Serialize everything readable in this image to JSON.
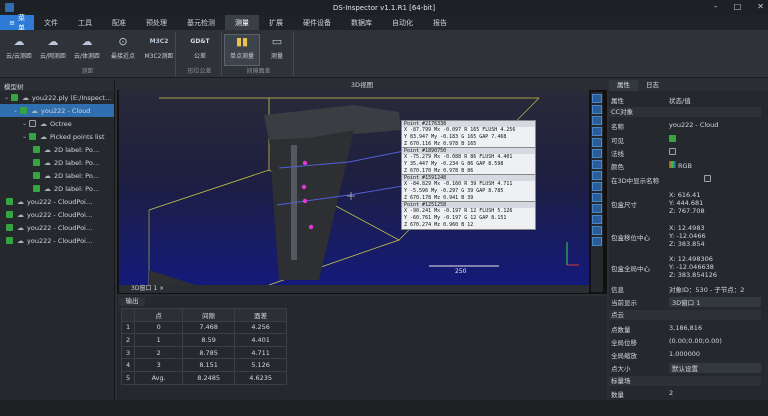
{
  "window": {
    "title": "DS-Inspector v1.1.R1 [64-bit]"
  },
  "menu": {
    "file_label": "菜单",
    "tabs": [
      "文件",
      "工具",
      "配准",
      "预处理",
      "基元检测",
      "测量",
      "扩展",
      "硬件设备",
      "数据库",
      "自动化",
      "报告"
    ],
    "active": "测量"
  },
  "ribbon": {
    "groups": [
      {
        "title": "测距",
        "buttons": [
          "云/云测距",
          "云/网测距",
          "云/体测距",
          "最接近点",
          "M3C2测距"
        ]
      },
      {
        "title": "形位公差",
        "buttons": [
          "公差"
        ]
      },
      {
        "title": "间隙面差",
        "buttons": [
          "单点测量",
          "测量"
        ]
      }
    ],
    "gdt_icon_text": "GD&T",
    "m3c2_icon_text": "M3C2"
  },
  "tree": {
    "header": "模型树",
    "items": [
      {
        "label": "you222.ply (E:/Inspect…",
        "level": 1,
        "checked": true,
        "selected": false
      },
      {
        "label": "you222 - Cloud",
        "level": 2,
        "checked": true,
        "selected": true
      },
      {
        "label": "Octree",
        "level": 3,
        "checked": false,
        "selected": false
      },
      {
        "label": "Picked points list",
        "level": 3,
        "checked": true,
        "selected": false
      },
      {
        "label": "2D label: Po…",
        "level": 4,
        "checked": true,
        "selected": false
      },
      {
        "label": "2D label: Po…",
        "level": 4,
        "checked": true,
        "selected": false
      },
      {
        "label": "2D label: Po…",
        "level": 4,
        "checked": true,
        "selected": false
      },
      {
        "label": "2D label: Po…",
        "level": 4,
        "checked": true,
        "selected": false
      },
      {
        "label": "you222 - CloudPoi…",
        "level": 1,
        "checked": true,
        "selected": false
      },
      {
        "label": "you222 - CloudPoi…",
        "level": 1,
        "checked": true,
        "selected": false
      },
      {
        "label": "you222 - CloudPoi…",
        "level": 1,
        "checked": true,
        "selected": false
      },
      {
        "label": "you222 - CloudPoi…",
        "level": 1,
        "checked": true,
        "selected": false
      }
    ]
  },
  "viewport": {
    "title": "3D视图",
    "tab_label": "3D窗口 1",
    "scale_label": "250",
    "points": [
      {
        "header": "Point #2176338",
        "rows": [
          "X  -87.799  Mx  -0.097  R  165  FLUSH  4.256",
          "Y   83.947  My  -0.183  G  165    GAP  7.468",
          "Z  670.116  Mz   0.978  B  165"
        ]
      },
      {
        "header": "Point #1890750",
        "rows": [
          "X  -75.279  Mx  -0.088  R   86  FLUSH  4.401",
          "Y   35.447  My  -0.234  G   86    GAP  8.598",
          "Z  670.170  Mz   0.978  B   86"
        ]
      },
      {
        "header": "Point #1591248",
        "rows": [
          "X  -84.829  Mx  -0.160  R   39  FLUSH  4.711",
          "Y   -5.596  My  -0.297  G   39    GAP  8.785",
          "Z  670.178  Mz   0.941  B   39"
        ]
      },
      {
        "header": "Point #1251258",
        "rows": [
          "X  -90.241  Mx  -0.197  R   12  FLUSH  5.126",
          "Y  -60.761  My  -0.197  G   12    GAP  8.151",
          "Z  670.274  Mz   0.960  B   12"
        ]
      }
    ]
  },
  "output": {
    "tab": "输出",
    "columns": [
      "",
      "点",
      "间隙",
      "面差"
    ],
    "rows": [
      [
        "1",
        "0",
        "7.468",
        "4.256"
      ],
      [
        "2",
        "1",
        "8.59",
        "4.401"
      ],
      [
        "3",
        "2",
        "8.785",
        "4.711"
      ],
      [
        "4",
        "3",
        "8.151",
        "5.126"
      ],
      [
        "5",
        "Avg.",
        "8.2485",
        "4.6235"
      ]
    ]
  },
  "properties": {
    "tabs": [
      "属性",
      "日志"
    ],
    "col_headers": [
      "属性",
      "状态/值"
    ],
    "sections": {
      "object": "CC对象",
      "cloud": "点云",
      "scalar": "标量场"
    },
    "rows": {
      "name_k": "名称",
      "name_v": "you222 - Cloud",
      "visible_k": "可见",
      "normals_k": "法线",
      "color_k": "颜色",
      "color_v": "RGB",
      "show3d_k": "在3D中显示名称",
      "box_dim_k": "包盒尺寸",
      "box_dim_v": [
        "X: 616.41",
        "Y: 444.681",
        "Z: 767.708"
      ],
      "shift_k": "包盒移位中心",
      "shift_v": [
        "X: 12.4983",
        "Y: -12.0466",
        "Z: 383.854"
      ],
      "global_k": "包盒全局中心",
      "global_v": [
        "X: 12.498306",
        "Y: -12.046638",
        "Z: 383.854126"
      ],
      "info_k": "信息",
      "info_v": "对象ID：530 - 子节点：2",
      "display_k": "当前显示",
      "display_v": "3D窗口 1",
      "points_k": "点数量",
      "points_v": "3,186,816",
      "gshift_k": "全局位移",
      "gshift_v": "(0.00;0.00;0.00)",
      "gscale_k": "全局缩放",
      "gscale_v": "1.000000",
      "psize_k": "点大小",
      "psize_v": "默认设置",
      "count_k": "数量",
      "count_v": "2"
    }
  }
}
